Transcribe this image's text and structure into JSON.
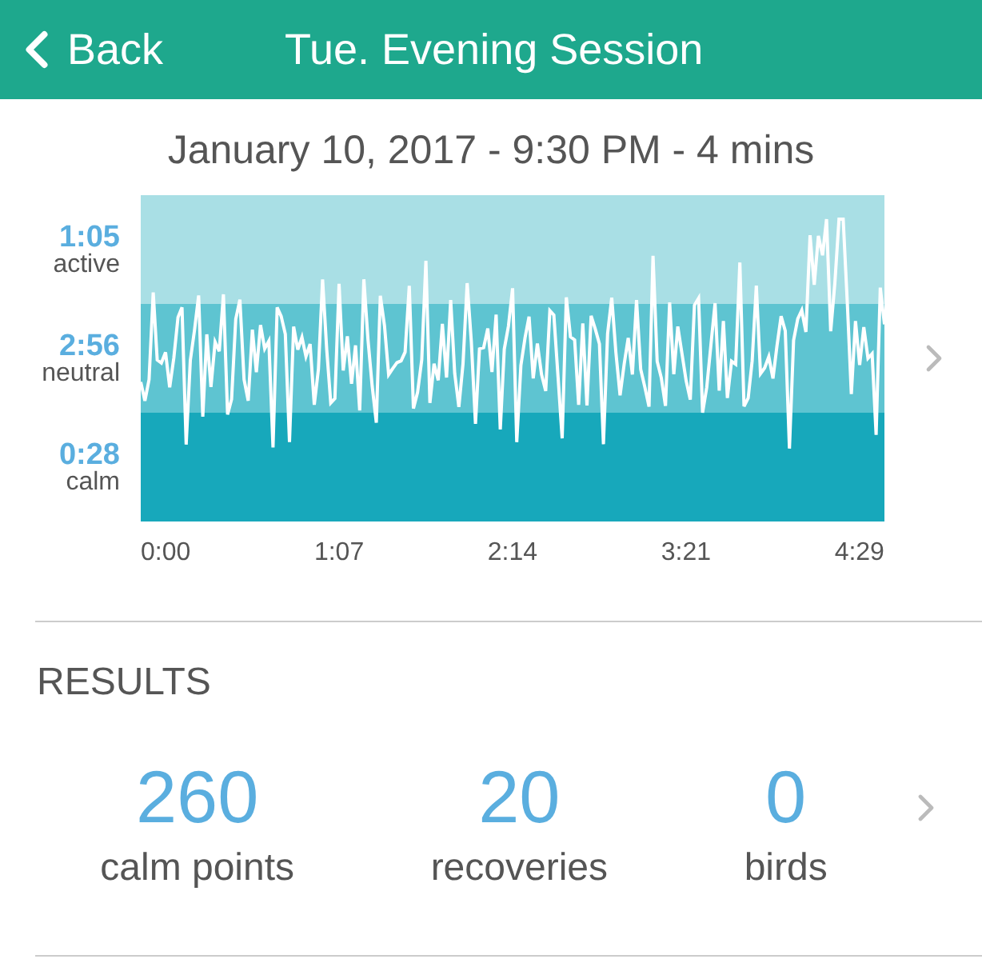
{
  "header": {
    "back": "Back",
    "title": "Tue. Evening Session"
  },
  "session": {
    "summary": "January 10, 2017 - 9:30 PM - 4 mins",
    "zones": [
      {
        "time": "1:05",
        "label": "active"
      },
      {
        "time": "2:56",
        "label": "neutral"
      },
      {
        "time": "0:28",
        "label": "calm"
      }
    ],
    "x_ticks": [
      "0:00",
      "1:07",
      "2:14",
      "3:21",
      "4:29"
    ]
  },
  "results": {
    "title": "RESULTS",
    "stats": [
      {
        "value": "260",
        "label": "calm points"
      },
      {
        "value": "20",
        "label": "recoveries"
      },
      {
        "value": "0",
        "label": "birds"
      }
    ]
  }
}
